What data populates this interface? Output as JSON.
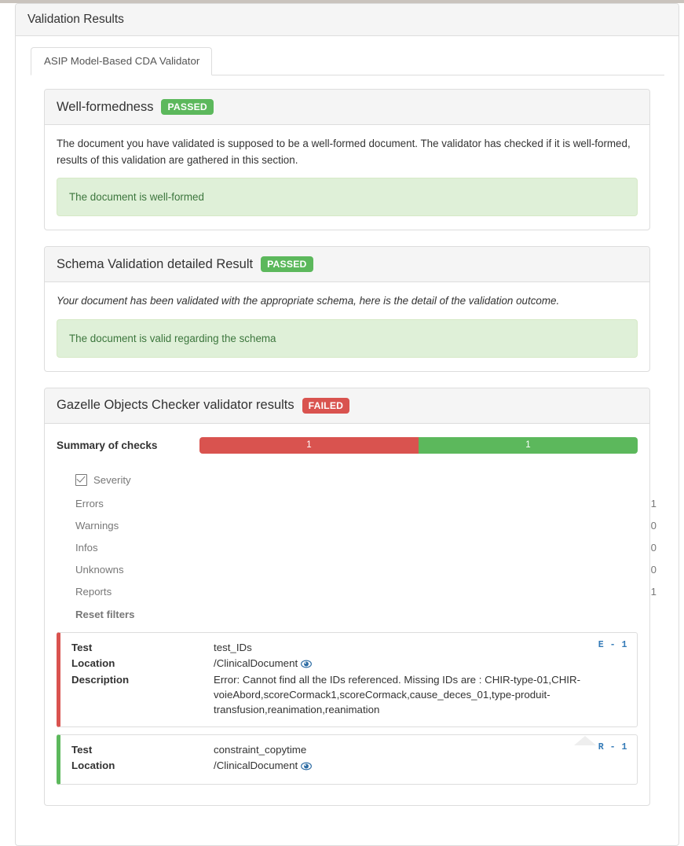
{
  "panel": {
    "title": "Validation Results"
  },
  "tabs": [
    {
      "label": "ASIP Model-Based CDA Validator",
      "active": true
    }
  ],
  "sections": [
    {
      "id": "well-formedness",
      "title": "Well-formedness",
      "status": "PASSED",
      "status_color": "#5cb85c",
      "intro": "The document you have validated is supposed to be a well-formed document. The validator has checked if it is well-formed, results of this validation are gathered in this section.",
      "intro_italic": false,
      "alert": "The document is well-formed"
    },
    {
      "id": "schema-validation",
      "title": "Schema Validation detailed Result",
      "status": "PASSED",
      "status_color": "#5cb85c",
      "intro": "Your document has been validated with the appropriate schema, here is the detail of the validation outcome.",
      "intro_italic": true,
      "alert": "The document is valid regarding the schema"
    }
  ],
  "gazelle": {
    "title": "Gazelle Objects Checker validator results",
    "status": "FAILED",
    "status_color": "#d9534f",
    "summary_label": "Summary of checks",
    "progress": {
      "segments": [
        {
          "name": "failed",
          "value": "1",
          "percent": 50,
          "color": "#d9534f"
        },
        {
          "name": "passed",
          "value": "1",
          "percent": 50,
          "color": "#5cb85c"
        }
      ]
    },
    "filters": {
      "header_label": "Severity",
      "header_icon": "checked-checkbox-icon",
      "rows": [
        {
          "label": "Errors",
          "count": "1"
        },
        {
          "label": "Warnings",
          "count": "0"
        },
        {
          "label": "Infos",
          "count": "0"
        },
        {
          "label": "Unknowns",
          "count": "0"
        },
        {
          "label": "Reports",
          "count": "1"
        }
      ],
      "reset_label": "Reset filters"
    },
    "field_labels": {
      "test": "Test",
      "location": "Location",
      "description": "Description"
    },
    "results": [
      {
        "severity": "error",
        "tag": "E - 1",
        "test": "test_IDs",
        "location": "/ClinicalDocument",
        "location_icon": "eye-icon",
        "description": "Error: Cannot find all the IDs referenced. Missing IDs are : CHIR-type-01,CHIR-voieAbord,scoreCormack1,scoreCormack,cause_deces_01,type-produit-transfusion,reanimation,reanimation"
      },
      {
        "severity": "report",
        "tag": "R - 1",
        "test": "constraint_copytime",
        "location": "/ClinicalDocument",
        "location_icon": "eye-icon",
        "description": null
      }
    ]
  },
  "scroll_top_icon": "scroll-to-top-arrow-icon"
}
